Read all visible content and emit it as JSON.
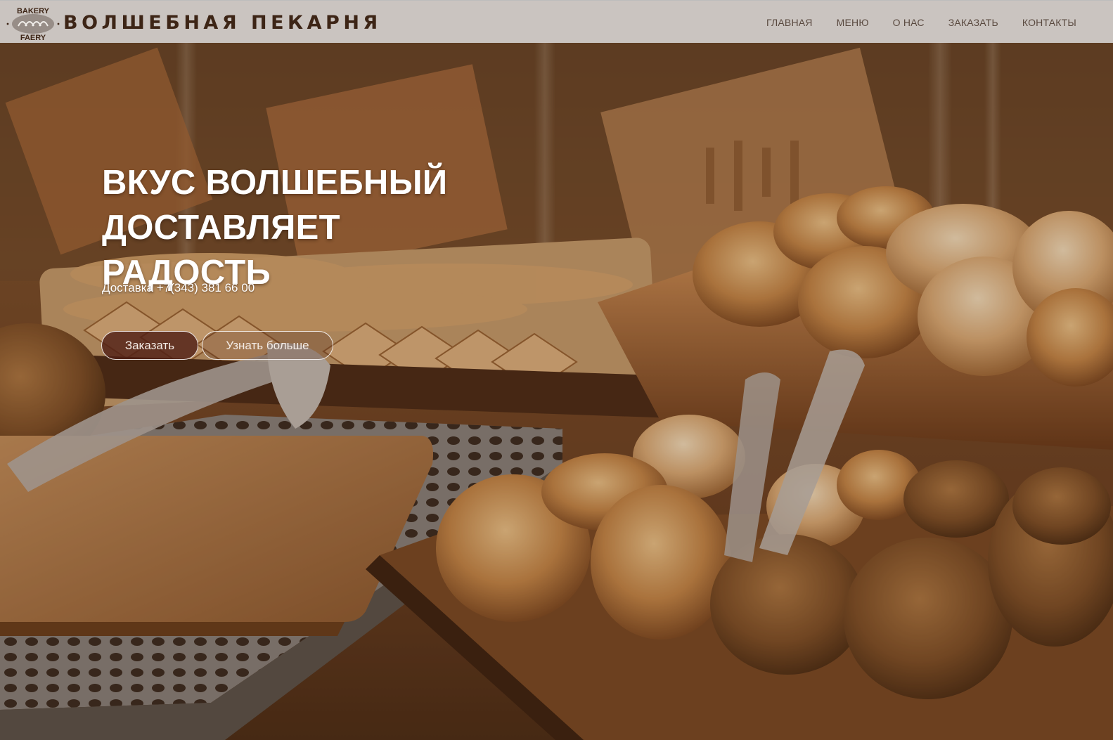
{
  "brand": {
    "logo_top": "BAKERY",
    "logo_bottom": "FAERY",
    "name": "ВОЛШЕБНАЯ ПЕКАРНЯ"
  },
  "nav": {
    "items": [
      {
        "label": "ГЛАВНАЯ"
      },
      {
        "label": "МЕНЮ"
      },
      {
        "label": "О НАС"
      },
      {
        "label": "ЗАКАЗАТЬ"
      },
      {
        "label": "КОНТАКТЫ"
      }
    ]
  },
  "hero": {
    "title_line1": "ВКУС ВОЛШЕБНЫЙ ДОСТАВЛЯЕТ",
    "title_line2": "РАДОСТЬ",
    "subtitle": "Доставка +7(343) 381 66 00",
    "btn_order": "Заказать",
    "btn_more": "Узнать больше",
    "background_icon": "bakery-photo"
  },
  "colors": {
    "brand_text": "#3d2516",
    "nav_text": "#5a4a40",
    "order_button": "#50201a",
    "hero_text": "#ffffff"
  }
}
